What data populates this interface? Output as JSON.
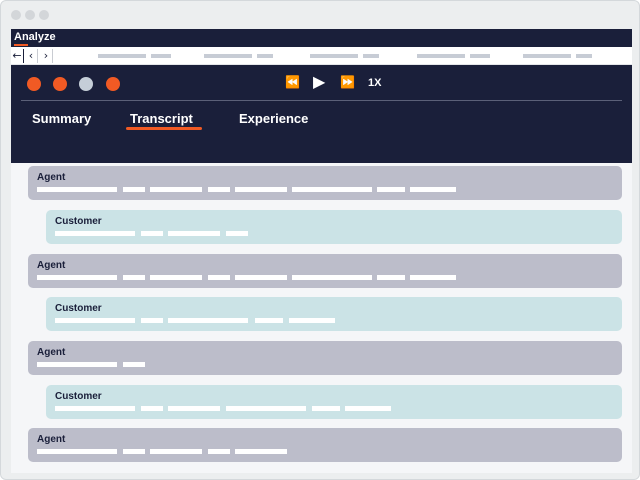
{
  "app": {
    "title": "Analyze"
  },
  "colors": {
    "navy": "#1a1f3a",
    "accent": "#f15a24",
    "agent_bubble": "#bcbdca",
    "customer_bubble": "#cbe3e6",
    "skeleton": "#ffffff"
  },
  "window_controls": [
    "close-dot-icon",
    "minimize-dot-icon",
    "maximize-dot-icon"
  ],
  "navigation": {
    "back_icon": "←",
    "prev_icon": "‹",
    "next_icon": "›"
  },
  "player": {
    "speaker_indicators": [
      "orange",
      "orange",
      "gray",
      "orange"
    ],
    "rewind_icon": "⏪",
    "play_icon": "▶",
    "forward_icon": "⏩",
    "speed_label": "1X"
  },
  "tabs": [
    {
      "label": "Summary",
      "active": false
    },
    {
      "label": "Transcript",
      "active": true
    },
    {
      "label": "Experience",
      "active": false
    }
  ],
  "transcript": [
    {
      "speaker": "Agent"
    },
    {
      "speaker": "Customer"
    },
    {
      "speaker": "Agent"
    },
    {
      "speaker": "Customer"
    },
    {
      "speaker": "Agent"
    },
    {
      "speaker": "Customer"
    },
    {
      "speaker": "Agent"
    }
  ]
}
